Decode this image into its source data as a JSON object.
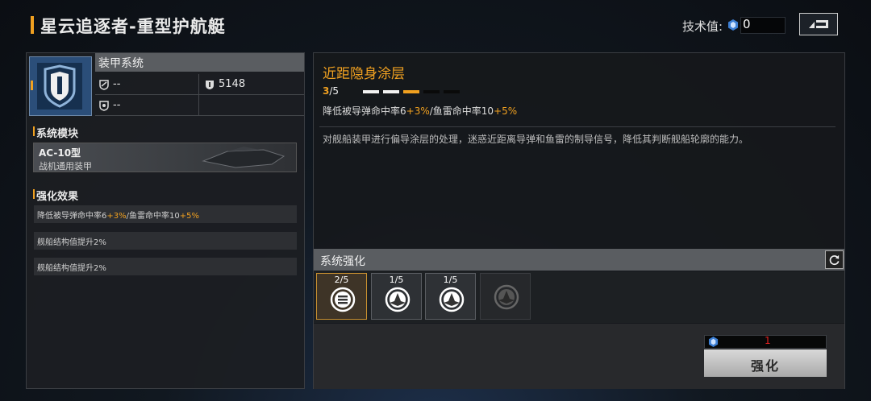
{
  "header": {
    "title": "星云追逐者-重型护航艇",
    "tech_label": "技术值:",
    "tech_value": "0",
    "tech_icon": "crystal-icon",
    "back_icon": "return-icon"
  },
  "armor": {
    "title": "装甲系统",
    "icon": "shield-icon",
    "stats": [
      {
        "icon": "missile-defense-icon",
        "value": "--"
      },
      {
        "icon": "hull-icon",
        "value": "5148"
      },
      {
        "icon": "torpedo-defense-icon",
        "value": "--"
      },
      {
        "icon": "",
        "value": ""
      }
    ]
  },
  "module": {
    "section_title": "系统模块",
    "name": "AC-10型",
    "subtitle": "战机通用装甲"
  },
  "enhance": {
    "section_title": "强化效果",
    "row1": {
      "pre": "降低被导弹命中率6",
      "a": "+3%",
      "mid": "/鱼雷命中率10",
      "b": "+5%"
    },
    "row2": "舰船结构值提升2%",
    "row3": "舰船结构值提升2%"
  },
  "skill": {
    "title": "近距隐身涂层",
    "level_current": "3",
    "level_max": "/5",
    "level_fraction": 0.6,
    "effect": {
      "pre": "降低被导弹命中率6",
      "a": "+3%",
      "mid": "/鱼雷命中率10",
      "b": "+5%"
    },
    "description": "对舰船装甲进行偏导涂层的处理，迷惑近距离导弹和鱼雷的制导信号，降低其判断舰船轮廓的能力。"
  },
  "system": {
    "section_title": "系统强化",
    "refresh_icon": "refresh-icon",
    "slots": [
      {
        "level": "2/5",
        "icon": "stealth-coating-icon",
        "active": true
      },
      {
        "level": "1/5",
        "icon": "ship-emblem-icon",
        "active": false
      },
      {
        "level": "1/5",
        "icon": "ship-emblem-icon",
        "active": false
      },
      {
        "level": "",
        "icon": "locked-ship-emblem-icon",
        "active": false
      }
    ]
  },
  "action": {
    "cost_icon": "crystal-icon",
    "cost": "1",
    "button_label": "强化"
  },
  "colors": {
    "accent": "#f0a020",
    "cost_red": "#e02020"
  }
}
